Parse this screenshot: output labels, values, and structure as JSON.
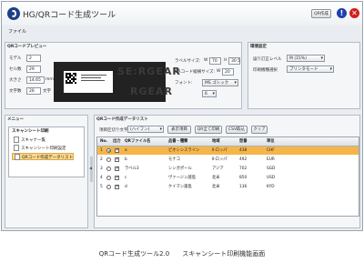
{
  "app": {
    "title": "HG/QRコード生成ツール",
    "menu_file": "ファイル",
    "btn_generate": "QR作成",
    "btn_info_icon": "info-icon",
    "btn_close_icon": "close-icon"
  },
  "preview_panel": {
    "title": "QRコードプレビュー",
    "model_label": "モデル",
    "model_value": "2",
    "cell_label": "セル数",
    "cell_value": "29",
    "size_label": "大きさ",
    "size_value": "14.65",
    "size_unit": "mm",
    "chars_label": "文字数",
    "chars_value": "26",
    "chars_unit": "文字",
    "label_size_label": "ラベルサイズ:",
    "label_w_prefix": "W",
    "label_w_value": "70",
    "label_h_prefix": "H",
    "label_h_value": "30.5",
    "qr_size_label": "QRコード縦横サイズ:",
    "qr_size_prefix": "W",
    "qr_size_value": "20",
    "font_label": "フォント:",
    "font_value": "MS ゴシック",
    "font_size_value": "6",
    "ghost_text_1": "SE:RGEAR",
    "ghost_text_2": "RGEAR"
  },
  "env_panel": {
    "title": "環境設定",
    "ecc_label": "誤り訂正レベル",
    "ecc_value": "M (15%)",
    "print_mode_label": "印刷機種選択",
    "print_mode_value": "プリンタモード"
  },
  "menu_panel": {
    "title": "メニュー",
    "section": "スキャンシート印刷",
    "items": [
      {
        "label": "スキャナ一覧"
      },
      {
        "label": "スキャンシート印刷設定"
      },
      {
        "label": "QRコード作成データリスト"
      }
    ]
  },
  "list_panel": {
    "title": "QRコード作成データリスト",
    "delimiter_label": "項目区切り文字",
    "delimiter_value": "(ハイフン)",
    "buttons": {
      "display": "表示項目",
      "print": "QR全て印刷",
      "csv": "CSV取込",
      "clear": "クリア"
    },
    "columns": [
      "No.",
      "出力",
      "QRファイル名",
      "品番・種類",
      "地域",
      "型番",
      "単位"
    ],
    "rows": [
      {
        "no": "1",
        "out": true,
        "file": "a",
        "item": "ピオシンスライン",
        "region": "Ⅱ-ロッパ",
        "model": "438",
        "unit": "CHF",
        "selected": true
      },
      {
        "no": "2",
        "out": true,
        "file": "b",
        "item": "モナコ",
        "region": "Ⅱ-ロッパ",
        "model": "492",
        "unit": "EUR",
        "selected": false
      },
      {
        "no": "3",
        "out": true,
        "file": "ラベル3",
        "item": "シンガポール",
        "region": "アジア",
        "model": "702",
        "unit": "SGD",
        "selected": false
      },
      {
        "no": "4",
        "out": true,
        "file": "c",
        "item": "ヴァージン諸島",
        "region": "北米",
        "model": "850",
        "unit": "USD",
        "selected": false
      },
      {
        "no": "5",
        "out": true,
        "file": "d",
        "item": "ケイマン諸島",
        "region": "北米",
        "model": "136",
        "unit": "KYD",
        "selected": false
      }
    ]
  },
  "caption": "QRコード生成ツール2.0　　スキャンシート印刷機能画面",
  "colors": {
    "selected_row": "#f5b54a",
    "window_bg": "#e9edf1",
    "info_button": "#1f3fb0",
    "close_button": "#d0201c"
  }
}
